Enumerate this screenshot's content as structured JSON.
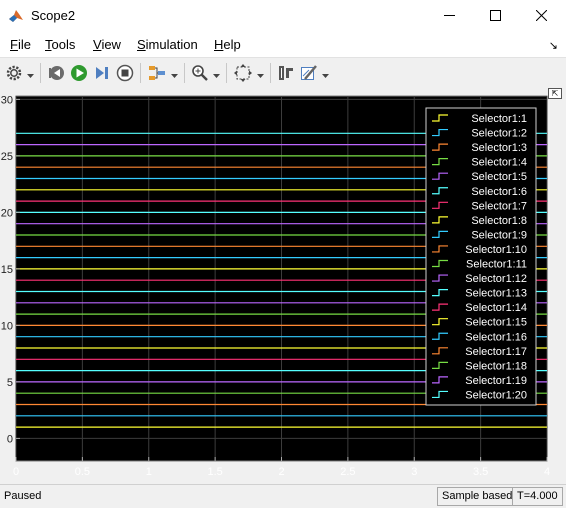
{
  "window": {
    "title": "Scope2",
    "controls": {
      "minimize": "–",
      "maximize": "□",
      "close": "✕"
    }
  },
  "menu": {
    "items": [
      {
        "mnemonic": "F",
        "rest": "ile"
      },
      {
        "mnemonic": "T",
        "rest": "ools"
      },
      {
        "mnemonic": "V",
        "rest": "iew"
      },
      {
        "mnemonic": "S",
        "rest": "imulation"
      },
      {
        "mnemonic": "H",
        "rest": "elp"
      }
    ],
    "right_glyph": "↘"
  },
  "toolbar": {
    "icons": [
      "settings-gear-icon",
      "step-back-icon",
      "run-icon",
      "step-forward-icon",
      "stop-icon",
      "signal-triggers-icon",
      "zoom-icon",
      "fit-to-view-icon",
      "cursor-measurements-icon",
      "style-edit-icon"
    ]
  },
  "plot": {
    "restore_glyph": "⇱",
    "background": "#000000",
    "grid_color": "#3c3c3c",
    "axis_text_color": "#ffffff"
  },
  "chart_data": {
    "type": "line",
    "x": [
      0,
      4
    ],
    "xlim": [
      0,
      4
    ],
    "ylim": [
      -2,
      30.3
    ],
    "xticks": [
      0,
      0.5,
      1,
      1.5,
      2,
      2.5,
      3,
      3.5,
      4
    ],
    "xtick_labels": [
      "0",
      "0.5",
      "1",
      "1.5",
      "2",
      "2.5",
      "3",
      "3.5",
      "4"
    ],
    "yticks": [
      0,
      5,
      10,
      15,
      20,
      25,
      30
    ],
    "ytick_labels": [
      "0",
      "5",
      "10",
      "15",
      "20",
      "25",
      "30"
    ],
    "grid": true,
    "legend_position": "top-right",
    "series": [
      {
        "name": "Selector1:1",
        "color": "#ffff33",
        "values": [
          1,
          1
        ]
      },
      {
        "name": "Selector1:2",
        "color": "#33ccff",
        "values": [
          2,
          2
        ]
      },
      {
        "name": "Selector1:3",
        "color": "#ff8833",
        "values": [
          3,
          3
        ]
      },
      {
        "name": "Selector1:4",
        "color": "#77dd44",
        "values": [
          4,
          4
        ]
      },
      {
        "name": "Selector1:5",
        "color": "#bb66ff",
        "values": [
          5,
          5
        ]
      },
      {
        "name": "Selector1:6",
        "color": "#55ffff",
        "values": [
          6,
          6
        ]
      },
      {
        "name": "Selector1:7",
        "color": "#ff3377",
        "values": [
          7,
          7
        ]
      },
      {
        "name": "Selector1:8",
        "color": "#ffff33",
        "values": [
          8,
          8
        ]
      },
      {
        "name": "Selector1:9",
        "color": "#33ccff",
        "values": [
          9,
          9
        ]
      },
      {
        "name": "Selector1:10",
        "color": "#ff8833",
        "values": [
          10,
          10
        ]
      },
      {
        "name": "Selector1:11",
        "color": "#77dd44",
        "values": [
          11,
          11
        ]
      },
      {
        "name": "Selector1:12",
        "color": "#bb66ff",
        "values": [
          12,
          12
        ]
      },
      {
        "name": "Selector1:13",
        "color": "#55ffff",
        "values": [
          13,
          13
        ]
      },
      {
        "name": "Selector1:14",
        "color": "#ff3377",
        "values": [
          14,
          14
        ]
      },
      {
        "name": "Selector1:15",
        "color": "#ffff33",
        "values": [
          15,
          15
        ]
      },
      {
        "name": "Selector1:16",
        "color": "#33ccff",
        "values": [
          16,
          16
        ]
      },
      {
        "name": "Selector1:17",
        "color": "#ff8833",
        "values": [
          17,
          17
        ]
      },
      {
        "name": "Selector1:18",
        "color": "#77dd44",
        "values": [
          18,
          18
        ]
      },
      {
        "name": "Selector1:19",
        "color": "#bb66ff",
        "values": [
          19,
          19
        ]
      },
      {
        "name": "Selector1:20",
        "color": "#55ffff",
        "values": [
          20,
          20
        ]
      },
      {
        "name": "",
        "color": "#ff3377",
        "values": [
          21,
          21
        ]
      },
      {
        "name": "",
        "color": "#ffff33",
        "values": [
          22,
          22
        ]
      },
      {
        "name": "",
        "color": "#33ccff",
        "values": [
          23,
          23
        ]
      },
      {
        "name": "",
        "color": "#ff8833",
        "values": [
          24,
          24
        ]
      },
      {
        "name": "",
        "color": "#77dd44",
        "values": [
          25,
          25
        ]
      },
      {
        "name": "",
        "color": "#bb66ff",
        "values": [
          26,
          26
        ]
      },
      {
        "name": "",
        "color": "#55ffff",
        "values": [
          27,
          27
        ]
      }
    ]
  },
  "status": {
    "state": "Paused",
    "sample_mode": "Sample based",
    "time": "T=4.000"
  }
}
